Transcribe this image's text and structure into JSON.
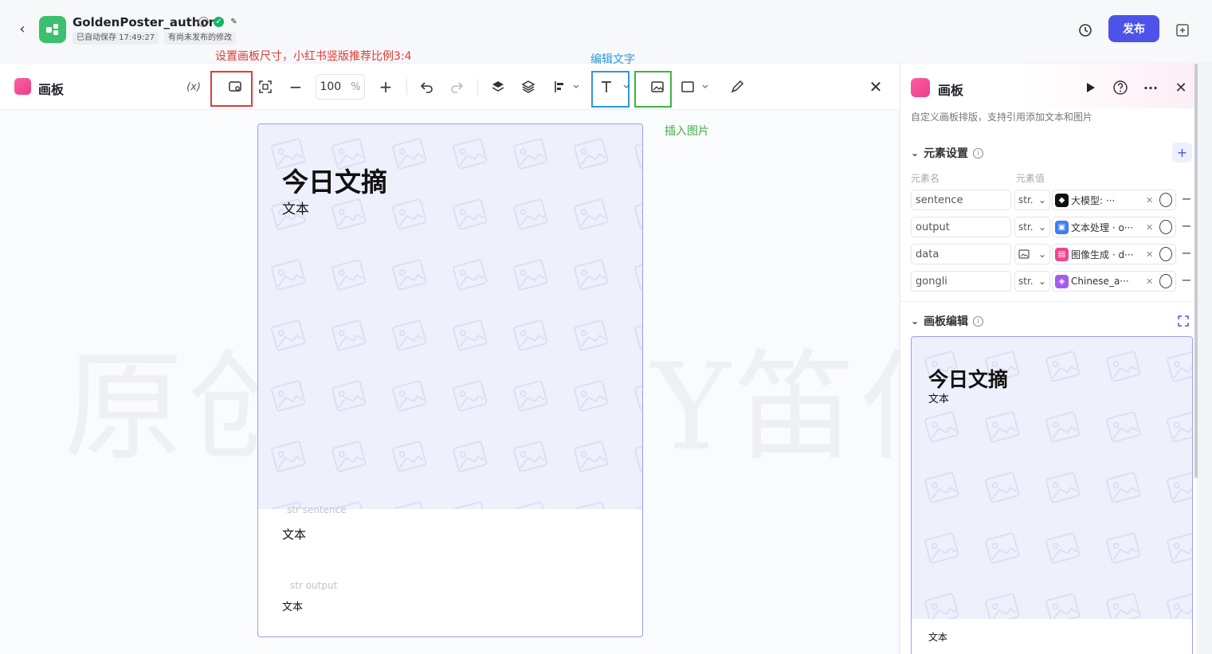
{
  "header": {
    "app_title": "GoldenPoster_author",
    "autosave": "已自动保存 17:49:27",
    "unpublished": "有尚未发布的修改",
    "publish_label": "发布"
  },
  "annotations": {
    "canvas_size": "设置画板尺寸，小红书竖版推荐比例3:4",
    "edit_text": "编辑文字",
    "insert_image": "插入图片"
  },
  "editor": {
    "title": "画板",
    "variable_label": "(x)",
    "zoom_value": "100",
    "zoom_unit": "%",
    "watermark": "原创内容BY笛仁杰"
  },
  "canvas": {
    "title": "今日文摘",
    "subtitle": "文本",
    "ph1": "str sentence",
    "text1": "文本",
    "ph2": "str output",
    "text2": "文本"
  },
  "panel": {
    "title": "画板",
    "description": "自定义画板排版，支持引用添加文本和图片",
    "elements_section": "元素设置",
    "col_name": "元素名",
    "col_value": "元素值",
    "rows": [
      {
        "name": "sentence",
        "type": "str.",
        "value": "大模型: ···",
        "icon_color": "#111111"
      },
      {
        "name": "output",
        "type": "str.",
        "value": "文本处理 · o···",
        "icon_color": "#3f7df5"
      },
      {
        "name": "data",
        "type": "",
        "value": "图像生成 · d···",
        "icon_color": "#f0458f"
      },
      {
        "name": "gongli",
        "type": "str.",
        "value": "Chinese_a···",
        "icon_color": "#a45bf0"
      }
    ],
    "editor_section": "画板编辑",
    "preview_title": "今日文摘",
    "preview_sub": "文本",
    "preview_text": "文本"
  }
}
